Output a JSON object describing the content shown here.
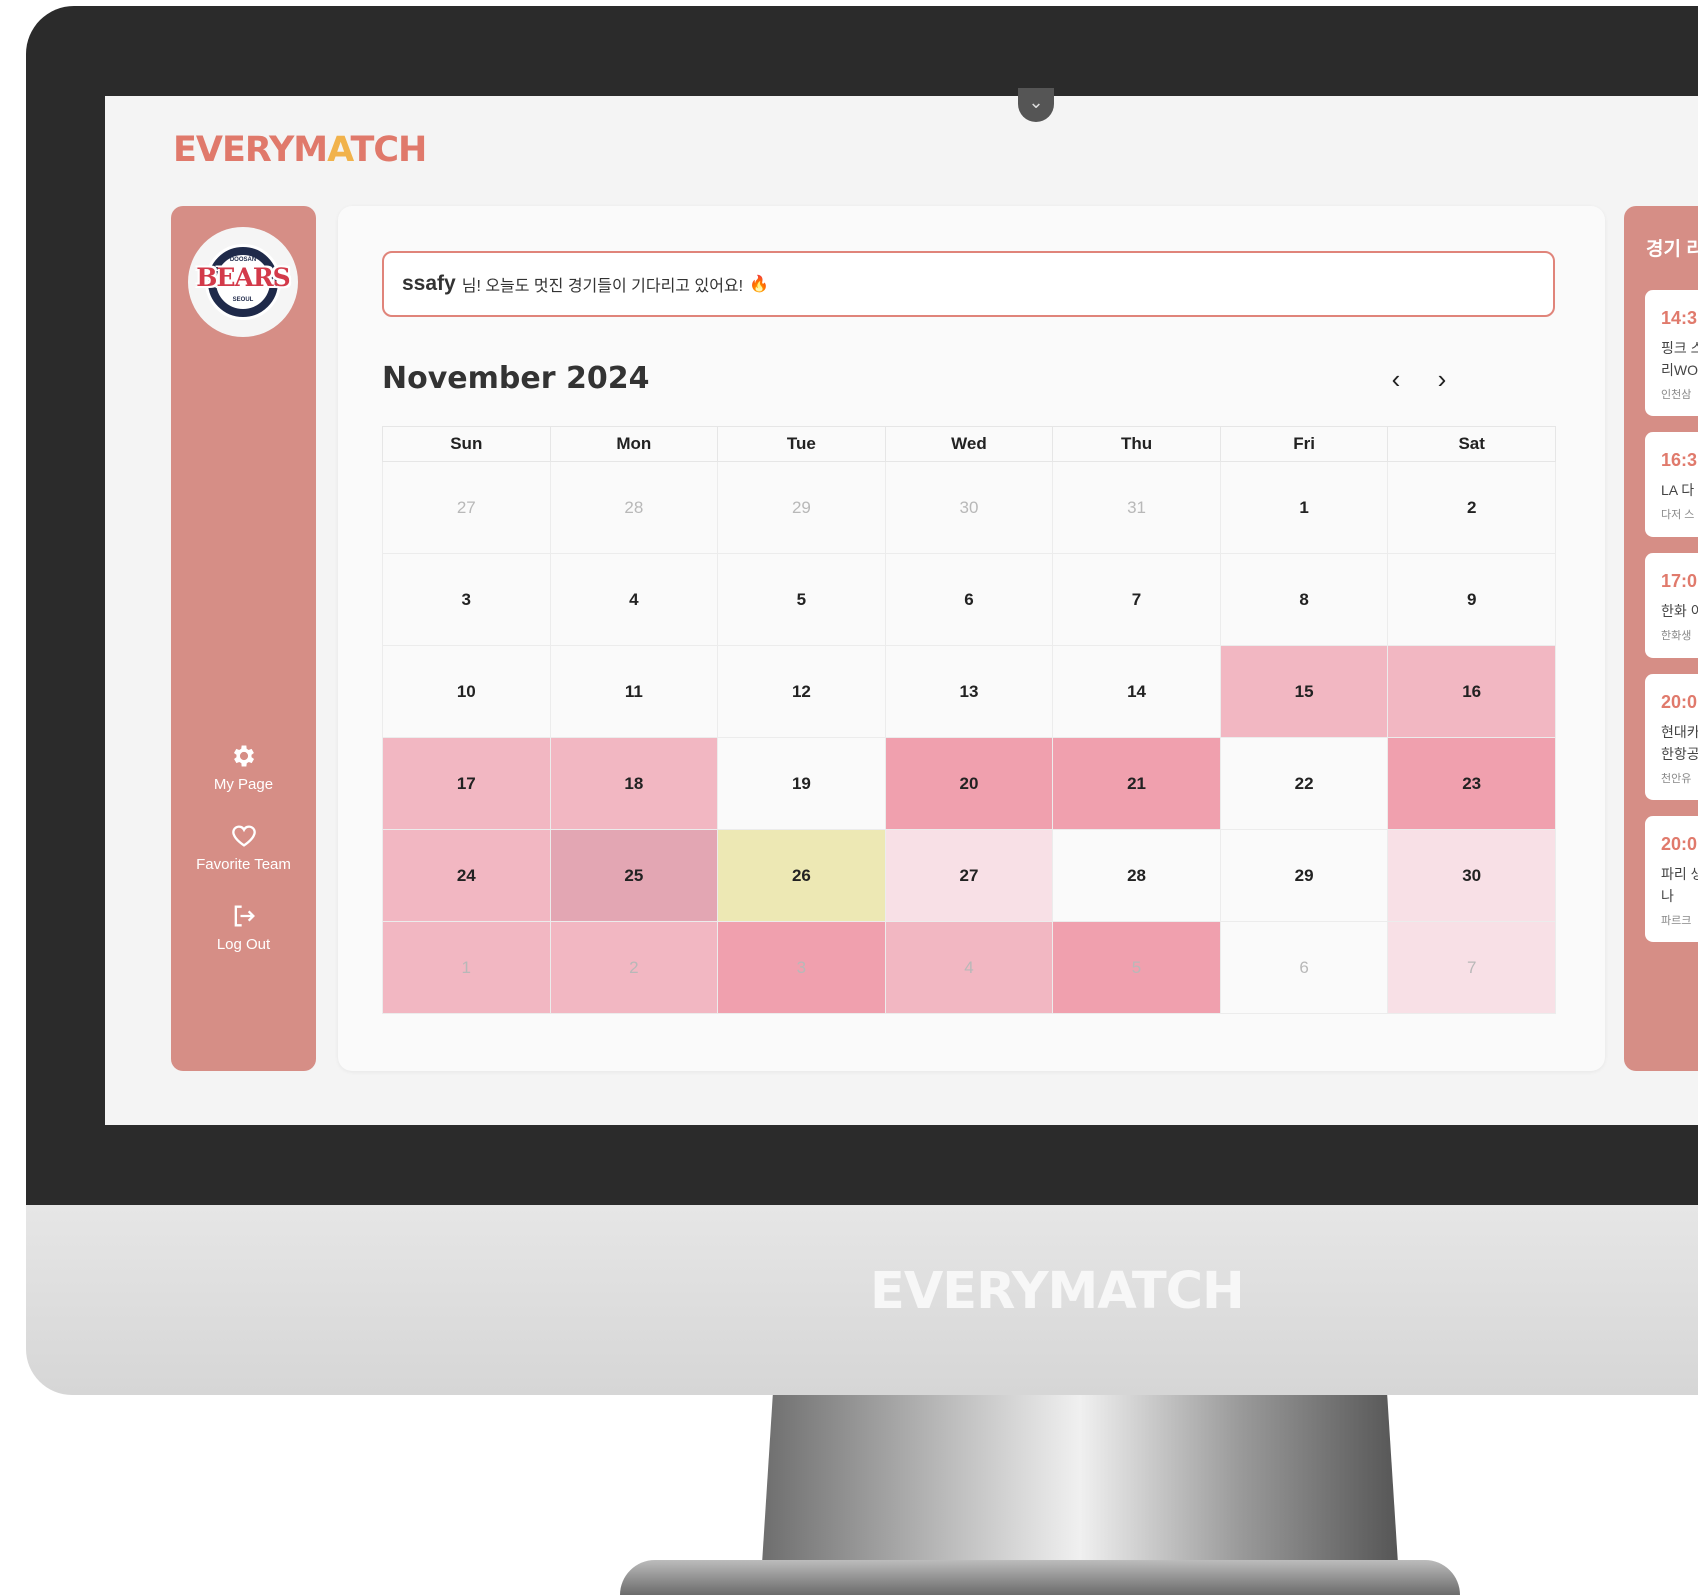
{
  "app": {
    "logo_pre": "EVERYM",
    "logo_a": "A",
    "logo_post": "TCH",
    "chin_logo": "EVERYMATCH"
  },
  "colors": {
    "brand": "#e0796b",
    "sidebar": "#d68e86",
    "match_light": "#f2b7c2",
    "match_medium": "#f0a0ae",
    "match_pale": "#f8e0e6",
    "match_muted": "#e3a6b3",
    "today": "#ede8b4"
  },
  "sidebar": {
    "avatar": {
      "top": "DOOSAN",
      "name": "BEARS",
      "bottom": "SEOUL"
    },
    "items": [
      {
        "label": "My Page",
        "icon": "gear-icon"
      },
      {
        "label": "Favorite Team",
        "icon": "heart-icon"
      },
      {
        "label": "Log Out",
        "icon": "logout-icon"
      }
    ]
  },
  "main": {
    "greeting_user": "ssafy",
    "greeting_text": "님! 오늘도 멋진 경기들이 기다리고 있어요!",
    "greeting_emoji": "🔥",
    "month_title": "November 2024",
    "prev_label": "‹",
    "next_label": "›",
    "weekdays": [
      "Sun",
      "Mon",
      "Tue",
      "Wed",
      "Thu",
      "Fri",
      "Sat"
    ],
    "weeks": [
      [
        {
          "d": "27",
          "out": true,
          "c": ""
        },
        {
          "d": "28",
          "out": true,
          "c": ""
        },
        {
          "d": "29",
          "out": true,
          "c": ""
        },
        {
          "d": "30",
          "out": true,
          "c": ""
        },
        {
          "d": "31",
          "out": true,
          "c": ""
        },
        {
          "d": "1",
          "out": false,
          "c": ""
        },
        {
          "d": "2",
          "out": false,
          "c": ""
        }
      ],
      [
        {
          "d": "3",
          "out": false,
          "c": ""
        },
        {
          "d": "4",
          "out": false,
          "c": ""
        },
        {
          "d": "5",
          "out": false,
          "c": ""
        },
        {
          "d": "6",
          "out": false,
          "c": ""
        },
        {
          "d": "7",
          "out": false,
          "c": ""
        },
        {
          "d": "8",
          "out": false,
          "c": ""
        },
        {
          "d": "9",
          "out": false,
          "c": ""
        }
      ],
      [
        {
          "d": "10",
          "out": false,
          "c": ""
        },
        {
          "d": "11",
          "out": false,
          "c": ""
        },
        {
          "d": "12",
          "out": false,
          "c": ""
        },
        {
          "d": "13",
          "out": false,
          "c": ""
        },
        {
          "d": "14",
          "out": false,
          "c": ""
        },
        {
          "d": "15",
          "out": false,
          "c": "#f2b7c2"
        },
        {
          "d": "16",
          "out": false,
          "c": "#f2b7c2"
        }
      ],
      [
        {
          "d": "17",
          "out": false,
          "c": "#f2b7c2"
        },
        {
          "d": "18",
          "out": false,
          "c": "#f2b7c2"
        },
        {
          "d": "19",
          "out": false,
          "c": ""
        },
        {
          "d": "20",
          "out": false,
          "c": "#f0a0ae"
        },
        {
          "d": "21",
          "out": false,
          "c": "#f0a0ae"
        },
        {
          "d": "22",
          "out": false,
          "c": ""
        },
        {
          "d": "23",
          "out": false,
          "c": "#f0a0ae"
        }
      ],
      [
        {
          "d": "24",
          "out": false,
          "c": "#f2b7c2"
        },
        {
          "d": "25",
          "out": false,
          "c": "#e3a6b3"
        },
        {
          "d": "26",
          "out": false,
          "c": "#ede8b4"
        },
        {
          "d": "27",
          "out": false,
          "c": "#f8e0e6"
        },
        {
          "d": "28",
          "out": false,
          "c": ""
        },
        {
          "d": "29",
          "out": false,
          "c": ""
        },
        {
          "d": "30",
          "out": false,
          "c": "#f8e0e6"
        }
      ],
      [
        {
          "d": "1",
          "out": true,
          "c": "#f2b7c2"
        },
        {
          "d": "2",
          "out": true,
          "c": "#f2b7c2"
        },
        {
          "d": "3",
          "out": true,
          "c": "#f0a0ae"
        },
        {
          "d": "4",
          "out": true,
          "c": "#f2b7c2"
        },
        {
          "d": "5",
          "out": true,
          "c": "#f0a0ae"
        },
        {
          "d": "6",
          "out": true,
          "c": ""
        },
        {
          "d": "7",
          "out": true,
          "c": "#f8e0e6"
        }
      ]
    ]
  },
  "right_panel": {
    "title": "경기 리",
    "matches": [
      {
        "time": "14:3",
        "lines": [
          "핑크 스",
          "리WO"
        ],
        "venue": "인천삼"
      },
      {
        "time": "16:3",
        "lines": [
          "LA 다"
        ],
        "venue": "다저 스"
      },
      {
        "time": "17:0",
        "lines": [
          "한화 이"
        ],
        "venue": "한화생"
      },
      {
        "time": "20:0",
        "lines": [
          "현대카",
          "한항공"
        ],
        "venue": "천안유"
      },
      {
        "time": "20:0",
        "lines": [
          "파리 생",
          "나"
        ],
        "venue": "파르크"
      }
    ]
  }
}
